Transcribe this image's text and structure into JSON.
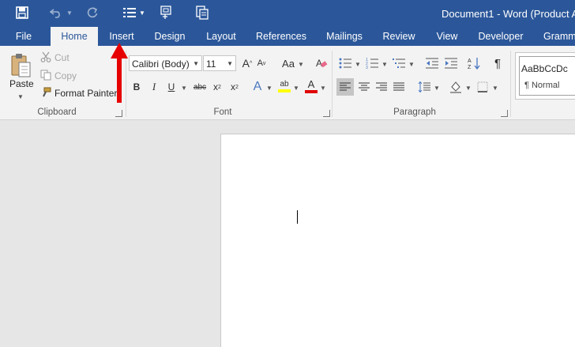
{
  "window": {
    "title": "Document1 - Word (Product Ac"
  },
  "tabs": [
    "File",
    "Home",
    "Insert",
    "Design",
    "Layout",
    "References",
    "Mailings",
    "Review",
    "View",
    "Developer",
    "Gramm"
  ],
  "clipboard": {
    "paste": "Paste",
    "cut": "Cut",
    "copy": "Copy",
    "format_painter": "Format Painter",
    "group_label": "Clipboard"
  },
  "font": {
    "name": "Calibri (Body)",
    "size": "11",
    "group_label": "Font",
    "grow": "A",
    "shrink": "A",
    "change_case": "Aa",
    "bold": "B",
    "italic": "I",
    "underline": "U",
    "strikethrough": "abc",
    "subscript": "x",
    "subscript_suffix": "2",
    "superscript": "x",
    "superscript_suffix": "2",
    "text_effects": "A",
    "highlight": "ab",
    "font_color": "A"
  },
  "paragraph": {
    "group_label": "Paragraph",
    "pilcrow": "¶"
  },
  "styles": {
    "preview": "AaBbCcDc",
    "name": "¶ Normal"
  },
  "colors": {
    "title_bar": "#2b579a",
    "ribbon": "#f3f3f3",
    "highlight": "#ffff00",
    "font_color": "#e00000",
    "annotation_arrow": "#e60000"
  }
}
